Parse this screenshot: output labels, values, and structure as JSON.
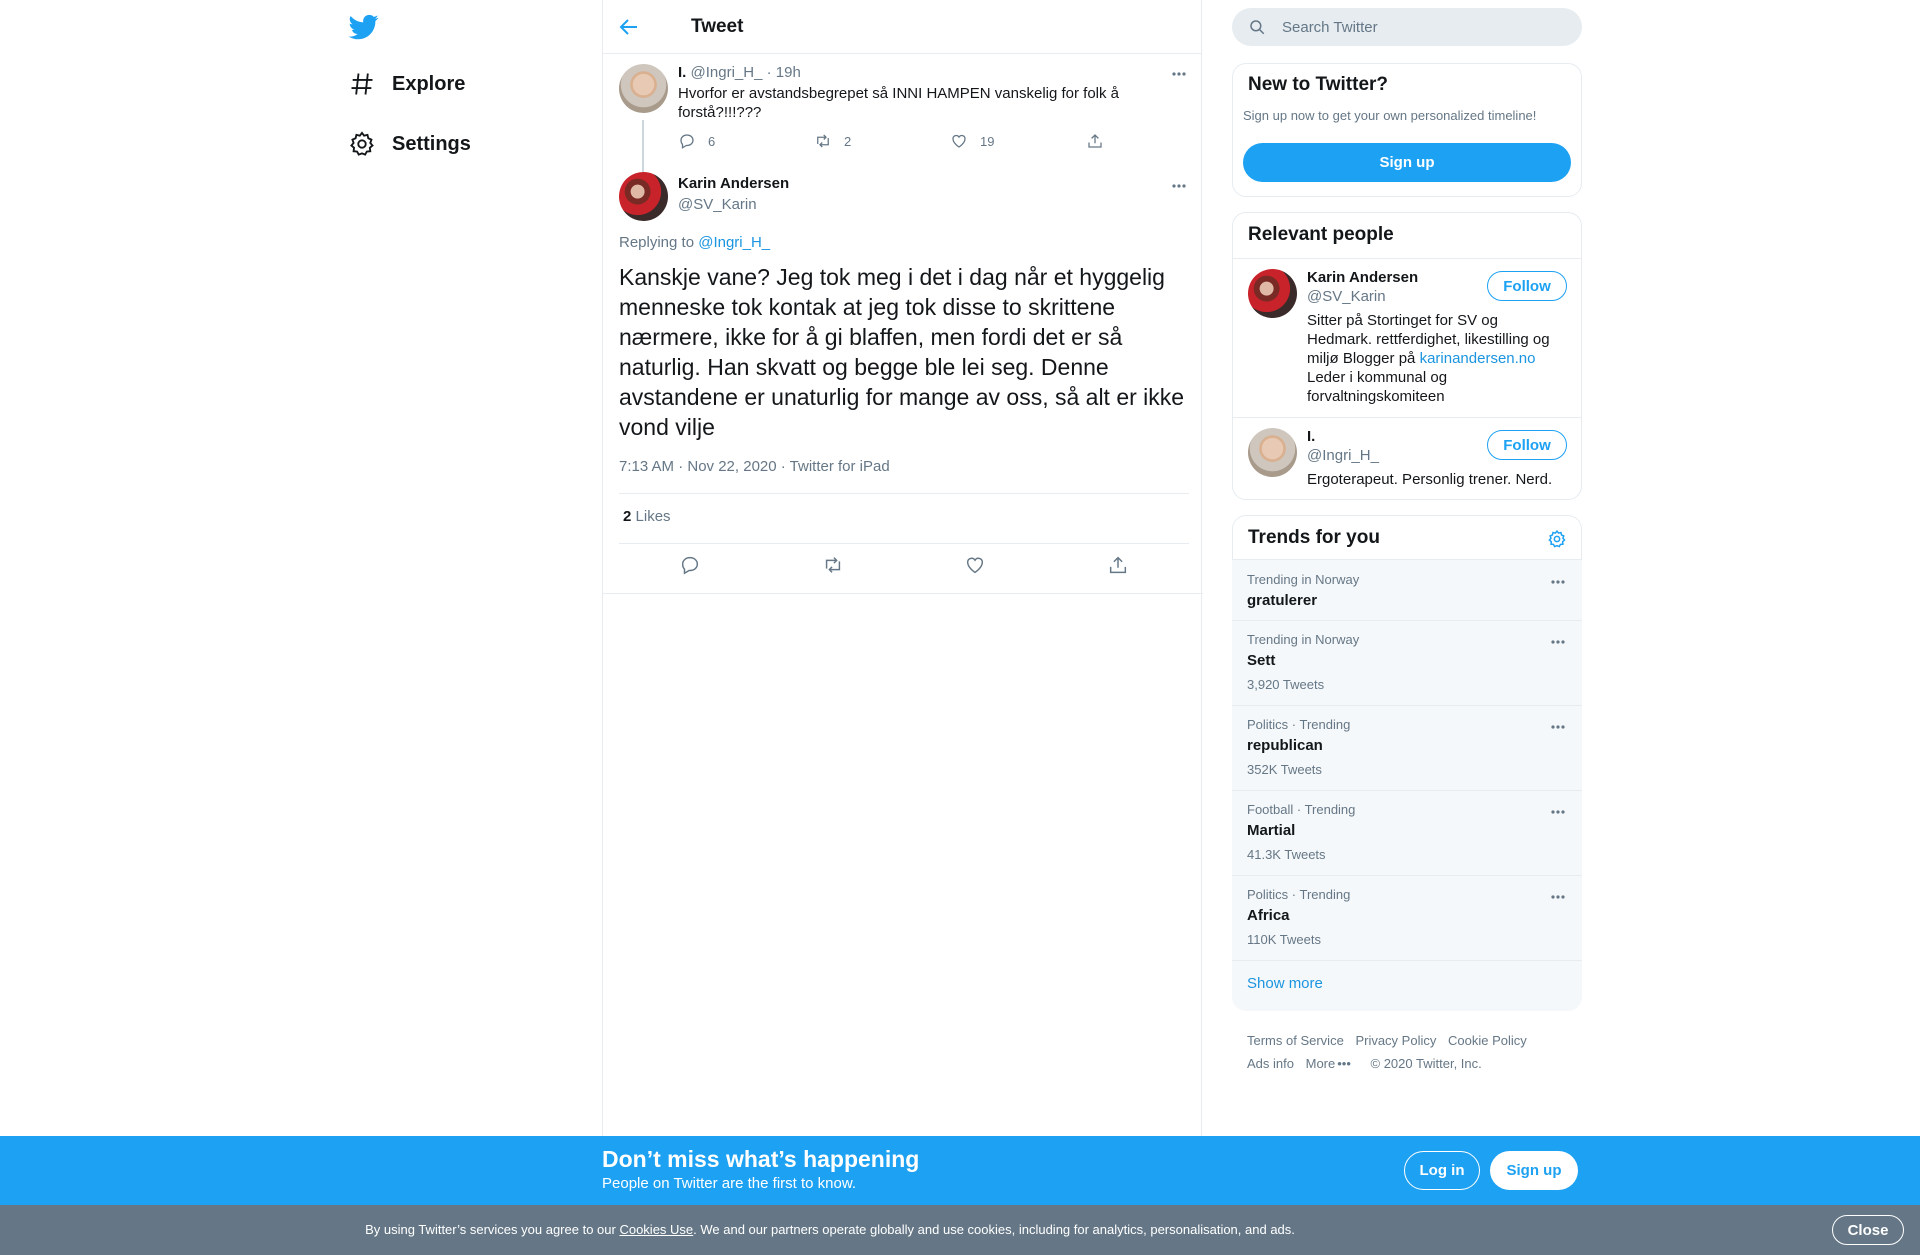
{
  "nav": {
    "logo": "twitter-bird-icon",
    "items": [
      {
        "label": "Explore",
        "icon": "hashtag-icon"
      },
      {
        "label": "Settings",
        "icon": "gear-icon"
      }
    ]
  },
  "header": {
    "title": "Tweet",
    "back_icon": "arrow-left-icon"
  },
  "parent_tweet": {
    "name": "I.",
    "handle": "@Ingri_H_",
    "time": "19h",
    "text": "Hvorfor er avstandsbegrepet så INNI HAMPEN vanskelig for folk å forstå?!!!???",
    "replies": "6",
    "retweets": "2",
    "likes": "19"
  },
  "tweet": {
    "name": "Karin Andersen",
    "handle": "@SV_Karin",
    "replying_prefix": "Replying to",
    "replying_to": "@Ingri_H_",
    "text": "Kanskje vane? Jeg tok meg i det i dag når et hyggelig menneske tok kontak at jeg tok disse to skrittene nærmere, ikke for å gi blaffen, men fordi det er så naturlig. Han skvatt og begge ble lei seg. Denne avstandene er unaturlig for mange av oss, så alt er ikke vond vilje",
    "meta": "7:13 AM · Nov 22, 2020 · Twitter for iPad",
    "likes_count": "2",
    "likes_label": "Likes"
  },
  "search": {
    "placeholder": "Search Twitter"
  },
  "new_to_twitter": {
    "title": "New to Twitter?",
    "subtitle": "Sign up now to get your own personalized timeline!",
    "button": "Sign up"
  },
  "relevant_people": {
    "title": "Relevant people",
    "people": [
      {
        "name": "Karin Andersen",
        "handle": "@SV_Karin",
        "bio_before": "Sitter på Stortinget for SV og Hedmark. rettferdighet, likestilling og miljø Blogger på",
        "bio_link": "karinandersen.no",
        "bio_after": "Leder i kommunal og forvaltningskomiteen",
        "follow": "Follow"
      },
      {
        "name": "I.",
        "handle": "@Ingri_H_",
        "bio": "Ergoterapeut. Personlig trener. Nerd.",
        "follow": "Follow"
      }
    ]
  },
  "trends": {
    "title": "Trends for you",
    "items": [
      {
        "context": "Trending in Norway",
        "name": "gratulerer",
        "count": ""
      },
      {
        "context": "Trending in Norway",
        "name": "Sett",
        "count": "3,920 Tweets"
      },
      {
        "context": "Politics · Trending",
        "name": "republican",
        "count": "352K Tweets"
      },
      {
        "context": "Football · Trending",
        "name": "Martial",
        "count": "41.3K Tweets"
      },
      {
        "context": "Politics · Trending",
        "name": "Africa",
        "count": "110K Tweets"
      }
    ],
    "show_more": "Show more"
  },
  "footer": {
    "links": [
      "Terms of Service",
      "Privacy Policy",
      "Cookie Policy",
      "Ads info",
      "More",
      "© 2020 Twitter, Inc."
    ]
  },
  "banner": {
    "title": "Don’t miss what’s happening",
    "subtitle": "People on Twitter are the first to know.",
    "login": "Log in",
    "signup": "Sign up"
  },
  "cookie": {
    "before": "By using Twitter’s services you agree to our",
    "link": "Cookies Use",
    "after": ". We and our partners operate globally and use cookies, including for analytics, personalisation, and ads.",
    "close": "Close"
  },
  "colors": {
    "accent": "#1da1f2",
    "link": "#1b95e0",
    "muted": "#657786",
    "cookie_bar": "#657786"
  }
}
